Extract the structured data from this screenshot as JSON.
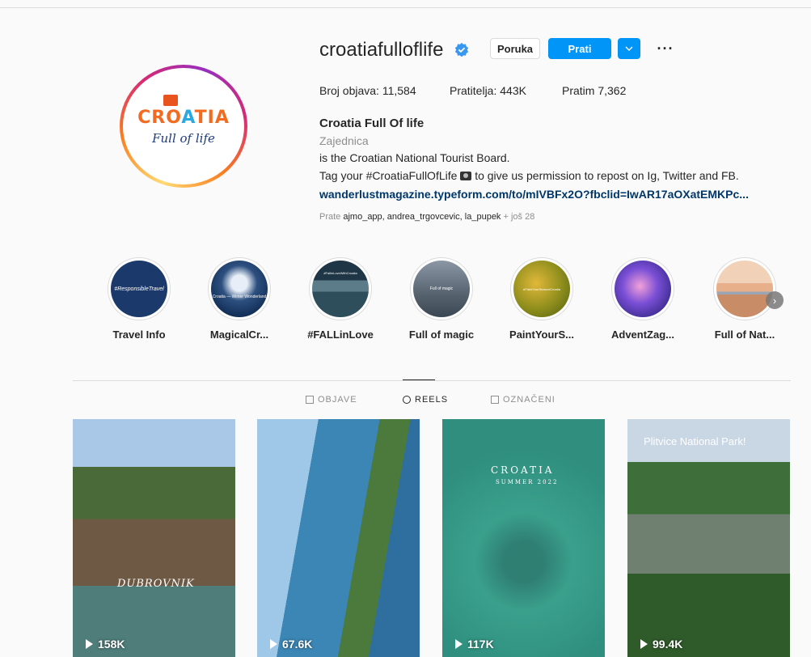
{
  "profile": {
    "username": "croatiafulloflife",
    "buttons": {
      "message": "Poruka",
      "follow": "Prati",
      "dropdown": "⌄",
      "more": "···"
    },
    "stats": {
      "posts": "Broj objava: 11,584",
      "followers": "Pratitelja: 443K",
      "following": "Pratim 7,362"
    },
    "full_name": "Croatia Full Of life",
    "category": "Zajednica",
    "bio_line1": "is the Croatian National Tourist Board.",
    "bio_line2_before": "Tag your #CroatiaFullOfLife",
    "bio_line2_after": "to give us permission to repost on Ig, Twitter and FB.",
    "bio_link": "wanderlustmagazine.typeform.com/to/mIVBFx2O?fbclid=IwAR17aOXatEMKPc...",
    "followed_by_prefix": "Prate",
    "followed_by_names": "ajmo_app, andrea_trgovcevic, la_pupek",
    "followed_by_more": "+ još 28",
    "logo": {
      "top_part1": "CRO",
      "top_part2": "A",
      "top_part3": "TIA",
      "bottom": "Full of life"
    }
  },
  "highlights": [
    {
      "label": "Travel Info",
      "cover_text": "#ResponsibleTravel",
      "color": "#1b3a6b"
    },
    {
      "label": "MagicalCr...",
      "cover_text": "Croatia — Winter Wonderland",
      "color": "#13335e"
    },
    {
      "label": "#FALLinLove",
      "cover_text": "#FallinLoveWithCroatia",
      "color": "#2b4b59"
    },
    {
      "label": "Full of magic",
      "cover_text": "Full of magic",
      "color": "#6f7d8c"
    },
    {
      "label": "PaintYourS...",
      "cover_text": "#PaintYourSeasonCroatia",
      "color": "#7d8a1d"
    },
    {
      "label": "AdventZag...",
      "cover_text": "",
      "color": "#5b3fa8"
    },
    {
      "label": "Full of Nat...",
      "cover_text": "",
      "color": "#c98a5a"
    }
  ],
  "highlights_next": "›",
  "tabs": [
    {
      "label": "OBJAVE",
      "active": false
    },
    {
      "label": "REELS",
      "active": true
    },
    {
      "label": "OZNAČENI",
      "active": false
    }
  ],
  "reels": [
    {
      "views": "158K",
      "caption": "DUBROVNIK"
    },
    {
      "views": "67.6K",
      "caption": ""
    },
    {
      "views": "117K",
      "caption": "CROATIA",
      "caption2": "SUMMER 2022"
    },
    {
      "views": "99.4K",
      "caption": "Plitvice National Park!"
    }
  ],
  "colors": {
    "accent": "#0095f6",
    "link": "#00376b",
    "muted": "#8e8e8e"
  }
}
